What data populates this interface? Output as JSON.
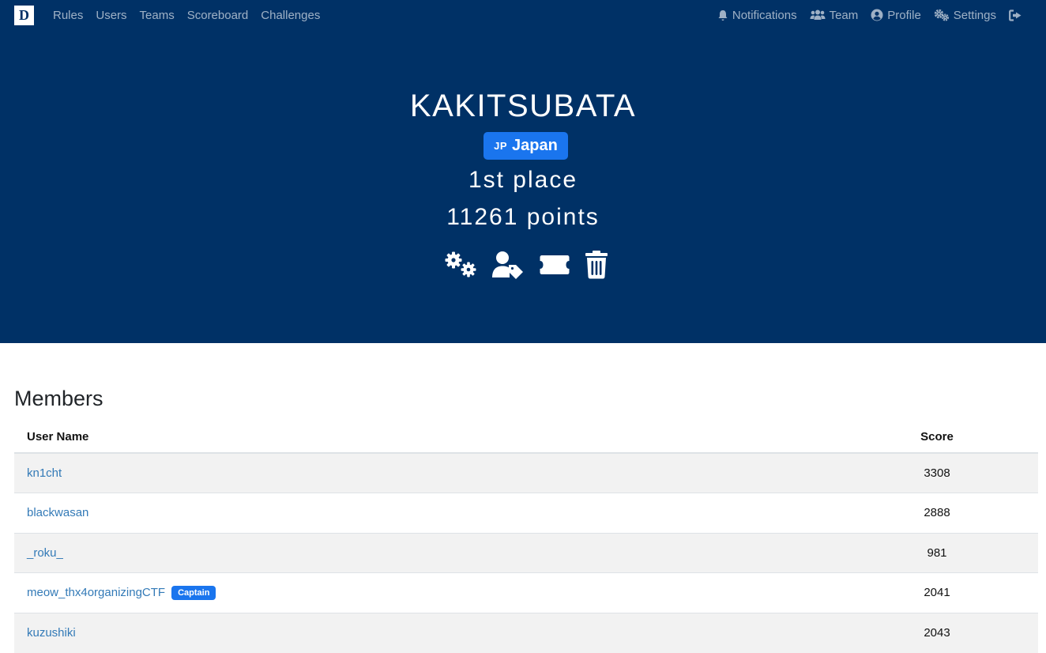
{
  "navbar": {
    "logo_text": "D",
    "left_links": [
      "Rules",
      "Users",
      "Teams",
      "Scoreboard",
      "Challenges"
    ],
    "right_links": [
      {
        "label": "Notifications",
        "icon": "bell-icon"
      },
      {
        "label": "Team",
        "icon": "users-icon"
      },
      {
        "label": "Profile",
        "icon": "user-circle-icon"
      },
      {
        "label": "Settings",
        "icon": "cogs-icon"
      },
      {
        "label": "",
        "icon": "sign-out-icon"
      }
    ]
  },
  "team": {
    "name": "KAKITSUBATA",
    "country_code": "JP",
    "country_name": "Japan",
    "place": "1st place",
    "points": "11261 points",
    "actions": [
      "cogs-icon",
      "user-tag-icon",
      "ticket-icon",
      "trash-icon"
    ]
  },
  "members": {
    "title": "Members",
    "columns": [
      "User Name",
      "Score"
    ],
    "rows": [
      {
        "name": "kn1cht",
        "score": "3308",
        "badge": ""
      },
      {
        "name": "blackwasan",
        "score": "2888",
        "badge": ""
      },
      {
        "name": "_roku_",
        "score": "981",
        "badge": ""
      },
      {
        "name": "meow_thx4organizingCTF",
        "score": "2041",
        "badge": "Captain"
      },
      {
        "name": "kuzushiki",
        "score": "2043",
        "badge": ""
      }
    ]
  },
  "colors": {
    "navy": "#003166",
    "badge_blue": "#1a75ee",
    "link": "#337ab7"
  }
}
